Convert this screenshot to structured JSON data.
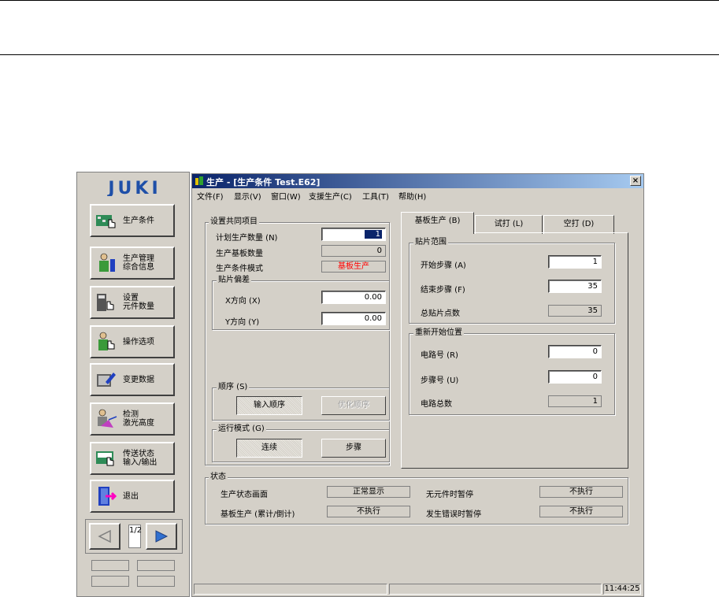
{
  "sidebar": {
    "logo": "JUKI",
    "buttons": [
      {
        "label": "生产条件"
      },
      {
        "label": "生产管理\n综合信息"
      },
      {
        "label": "设置\n元件数量"
      },
      {
        "label": "操作选项"
      },
      {
        "label": "变更数据"
      },
      {
        "label": "检测\n激光高度"
      },
      {
        "label": "传送状态\n输入/输出"
      },
      {
        "label": "退出"
      }
    ],
    "pager": {
      "page": "1/2"
    }
  },
  "window": {
    "title": "生产 - [生产条件 Test.E62]",
    "close": "×",
    "menu": [
      "文件(F)",
      "显示(V)",
      "窗口(W)",
      "支援生产(C)",
      "工具(T)",
      "帮助(H)"
    ]
  },
  "common": {
    "legend": "设置共同项目",
    "planned_label": "计划生产数量 (N)",
    "planned_value": "1",
    "produced_label": "生产基板数量",
    "produced_value": "0",
    "mode_label": "生产条件模式",
    "mode_value": "基板生产",
    "offset": {
      "legend": "贴片偏差",
      "x_label": "X方向 (X)",
      "x_value": "0.00",
      "y_label": "Y方向 (Y)",
      "y_value": "0.00"
    },
    "order": {
      "legend": "顺序 (S)",
      "input_order": "输入顺序",
      "optimize_order": "优化顺序"
    },
    "run_mode": {
      "legend": "运行模式 (G)",
      "continuous": "连续",
      "step": "步骤"
    }
  },
  "tabs": [
    {
      "label": "基板生产 (B)"
    },
    {
      "label": "试打 (L)"
    },
    {
      "label": "空打 (D)"
    }
  ],
  "board": {
    "range": {
      "legend": "贴片范围",
      "start_label": "开始步骤 (A)",
      "start_value": "1",
      "end_label": "结束步骤 (F)",
      "end_value": "35",
      "total_label": "总贴片点数",
      "total_value": "35"
    },
    "restart": {
      "legend": "重新开始位置",
      "circuit_label": "电路号 (R)",
      "circuit_value": "0",
      "step_label": "步骤号 (U)",
      "step_value": "0",
      "circuit_total_label": "电路总数",
      "circuit_total_value": "1"
    }
  },
  "status": {
    "legend": "状态",
    "screen_label": "生产状态画面",
    "screen_value": "正常显示",
    "nocomp_label": "无元件时暂停",
    "nocomp_value": "不执行",
    "count_label": "基板生产 (累计/倒计)",
    "count_value": "不执行",
    "error_label": "发生错误时暂停",
    "error_value": "不执行"
  },
  "statusbar": {
    "time": "11:44:25"
  },
  "colors": {
    "mode_value": "#ff0000",
    "titlebar": "#0a246a",
    "selected_field": "#0a246a"
  }
}
